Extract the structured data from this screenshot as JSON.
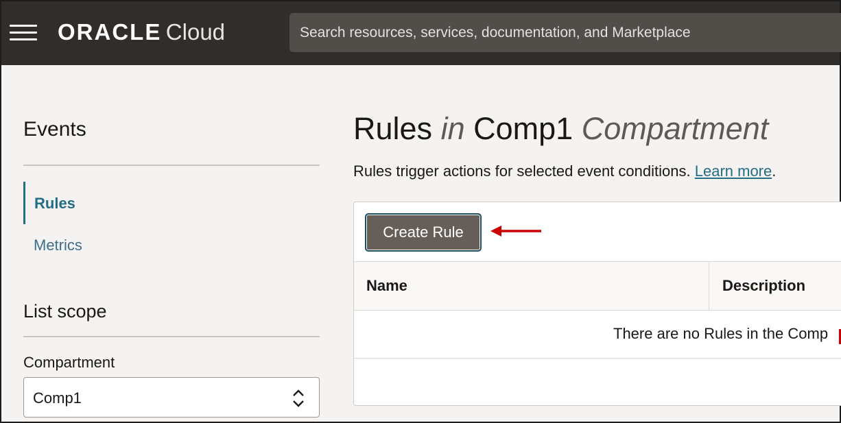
{
  "header": {
    "brand_oracle": "ORACLE",
    "brand_cloud": "Cloud",
    "search_placeholder": "Search resources, services, documentation, and Marketplace"
  },
  "sidebar": {
    "title": "Events",
    "items": [
      {
        "label": "Rules",
        "active": true
      },
      {
        "label": "Metrics",
        "active": false
      }
    ],
    "list_scope_title": "List scope",
    "compartment_label": "Compartment",
    "compartment_value": "Comp1"
  },
  "main": {
    "title_rules": "Rules",
    "title_in": "in",
    "title_comp": "Comp1",
    "title_compartment": "Compartment",
    "description": "Rules trigger actions for selected event conditions.",
    "learn_more": "Learn more",
    "description_end": ".",
    "create_button": "Create Rule",
    "table": {
      "columns": [
        "Name",
        "Description"
      ],
      "empty_message": "There are no Rules in the Comp"
    }
  },
  "colors": {
    "topbar": "#312d2a",
    "link": "#236d85",
    "button": "#665e59",
    "annotation_arrow": "#cc0000"
  },
  "icons": {
    "menu": "hamburger-menu-icon",
    "select": "chevron-up-down-icon",
    "annotation": "red-arrow-annotation"
  }
}
